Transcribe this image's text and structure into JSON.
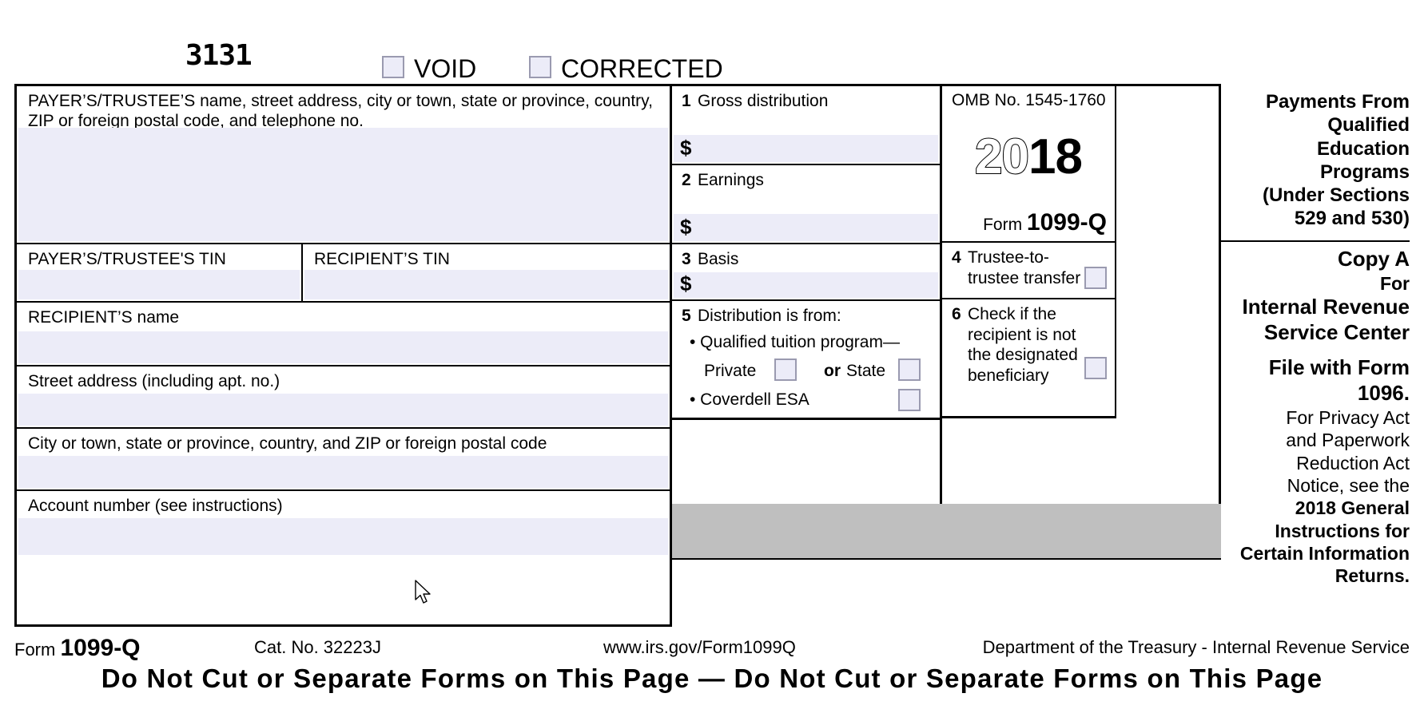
{
  "form": {
    "code": "3131",
    "void_label": "VOID",
    "corrected_label": "CORRECTED",
    "title_short": "1099-Q",
    "form_word": "Form"
  },
  "payer": {
    "name_caption": "PAYER’S/TRUSTEE’S name, street address, city or town, state or province, country, ZIP or foreign postal code, and telephone no.",
    "tin_caption": "PAYER’S/TRUSTEE'S TIN",
    "name_value": "",
    "tin_value": ""
  },
  "recipient": {
    "tin_caption": "RECIPIENT’S TIN",
    "name_caption": "RECIPIENT’S name",
    "street_caption": "Street address (including apt. no.)",
    "city_caption": "City or town, state or province, country, and ZIP or foreign postal code",
    "account_caption": "Account number (see instructions)",
    "tin_value": "",
    "name_value": "",
    "street_value": "",
    "city_value": "",
    "account_value": ""
  },
  "boxes": {
    "b1": {
      "num": "1",
      "label": "Gross distribution",
      "currency": "$",
      "value": ""
    },
    "b2": {
      "num": "2",
      "label": "Earnings",
      "currency": "$",
      "value": ""
    },
    "b3": {
      "num": "3",
      "label": "Basis",
      "currency": "$",
      "value": ""
    },
    "b4": {
      "num": "4",
      "label": "Trustee-to-trustee transfer",
      "checked": false
    },
    "b5": {
      "num": "5",
      "label": "Distribution is from:",
      "bullet1": "• Qualified tuition program—",
      "private_label": "Private",
      "or_label": "or",
      "state_label": "State",
      "bullet2": "• Coverdell ESA",
      "private_checked": false,
      "state_checked": false,
      "coverdell_checked": false
    },
    "b6": {
      "num": "6",
      "label": "Check if the recipient is not the designated beneficiary",
      "checked": false
    }
  },
  "omb": {
    "text": "OMB No. 1545-1760",
    "year_hollow": "20",
    "year_solid": "18",
    "form_word": "Form",
    "form_number": "1099-Q"
  },
  "heading": {
    "lines": [
      "Payments From",
      "Qualified",
      "Education",
      "Programs",
      "(Under Sections",
      "529 and 530)"
    ]
  },
  "copy": {
    "copy_a": "Copy A",
    "for": "For",
    "agency_line1": "Internal Revenue",
    "agency_line2": "Service Center",
    "file_with": "File with Form 1096.",
    "privacy_line1": "For Privacy Act",
    "privacy_line2": "and Paperwork",
    "privacy_line3": "Reduction Act",
    "privacy_line4": "Notice, see the",
    "general_line1": "2018 General",
    "general_line2": "Instructions for",
    "general_line3": "Certain Information",
    "general_line4": "Returns."
  },
  "footer": {
    "form_word": "Form",
    "form_number": "1099-Q",
    "cat_no": "Cat. No. 32223J",
    "url": "www.irs.gov/Form1099Q",
    "dept": "Department of the Treasury - Internal Revenue Service",
    "do_not_cut": "Do Not Cut or Separate Forms on This Page — Do Not Cut or Separate Forms on This Page"
  },
  "colors": {
    "field_fill": "#ececf8",
    "checkbox_border": "#9a9ab0",
    "gray_band": "#bfbfbf",
    "rule": "#000000"
  }
}
